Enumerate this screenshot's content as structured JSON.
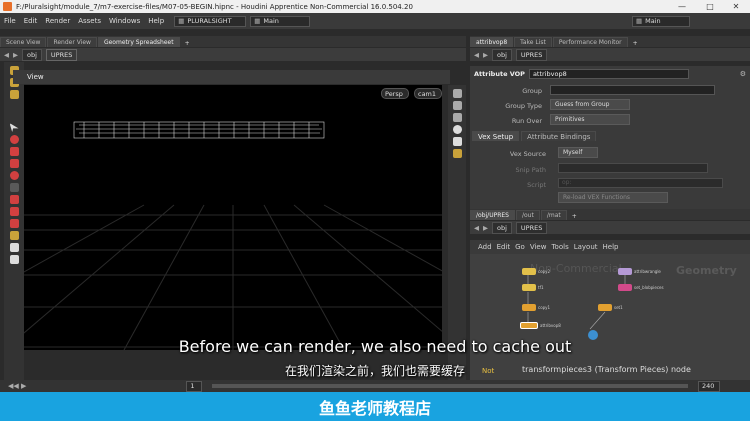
{
  "window": {
    "title": "F:/Pluralsight/module_7/m7-exercise-files/M07-05-BEGIN.hipnc - Houdini Apprentice Non-Commercial 16.0.504.20"
  },
  "menubar": {
    "items": [
      "File",
      "Edit",
      "Render",
      "Assets",
      "Windows",
      "Help"
    ],
    "shelf_set": "PLURALSIGHT",
    "desktop": "Main",
    "right_desktop": "Main"
  },
  "left_pane": {
    "tabs": [
      "Scene View",
      "Render View",
      "Geometry Spreadsheet"
    ],
    "path": [
      "obj",
      "UPRES"
    ],
    "view_label": "View",
    "camera_menu": "Persp",
    "cam_menu": "cam1"
  },
  "param_pane": {
    "tabs": [
      "attribvop8",
      "Take List",
      "Performance Monitor"
    ],
    "path": [
      "obj",
      "UPRES"
    ],
    "node_type": "Attribute VOP",
    "node_name": "attribvop8",
    "group_label": "Group",
    "group_value": "",
    "group_type_label": "Group Type",
    "group_type_value": "Guess from Group",
    "run_over_label": "Run Over",
    "run_over_value": "Primitives",
    "subtabs": [
      "Vex Setup",
      "Attribute Bindings"
    ],
    "vex_source_label": "Vex Source",
    "vex_source_value": "Myself",
    "snippet_label": "Snip Path",
    "script_label": "Script",
    "script_value": "op:",
    "reload_label": "Re-load VEX Functions"
  },
  "network_pane": {
    "tabs": [
      "/obj/UPRES",
      "/out",
      "/mat"
    ],
    "path": [
      "obj",
      "UPRES"
    ],
    "menu": [
      "Add",
      "Edit",
      "Go",
      "View",
      "Tools",
      "Layout",
      "Help"
    ],
    "watermark_noncommercial": "Non-Commercial",
    "watermark_geometry": "Geometry",
    "nodes": [
      {
        "name": "copy2"
      },
      {
        "name": "tf1"
      },
      {
        "name": "attribwrangle"
      },
      {
        "name": "set_blobpieces"
      },
      {
        "name": "copy1"
      },
      {
        "name": "set1"
      },
      {
        "name": "attribvop8"
      }
    ],
    "status_line": "transformpieces3 (Transform Pieces) node",
    "status_prefix": "Not"
  },
  "timeline": {
    "frame": "1",
    "end": "240"
  },
  "subtitles": {
    "en": "Before we can render, we also need to cache out",
    "zh": "在我们渲染之前，我们也需要缓存"
  },
  "banner": {
    "text": "鱼鱼老师教程店"
  },
  "colors": {
    "banner": "#19a3e0",
    "accent": "#e8702a"
  }
}
